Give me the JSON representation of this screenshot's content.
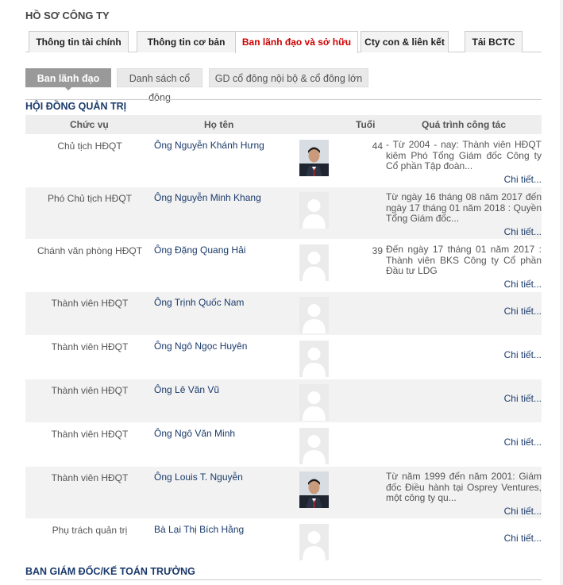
{
  "header": {
    "title": "HỒ SƠ CÔNG TY"
  },
  "tabs": [
    {
      "label": "Thông tin tài chính"
    },
    {
      "label": "Thông tin cơ bản"
    },
    {
      "label": "Ban lãnh đạo và sở hữu",
      "active": true
    },
    {
      "label": "Cty con & liên kết"
    },
    {
      "label": "Tải BCTC"
    }
  ],
  "subtabs": [
    {
      "label": "Ban lãnh đạo",
      "active": true
    },
    {
      "label": "Danh sách cổ đông"
    },
    {
      "label": "GD cổ đông nội bộ & cổ đông lớn"
    }
  ],
  "board": {
    "title": "HỘI ĐỒNG QUẢN TRỊ",
    "columns": {
      "position": "Chức vụ",
      "name": "Họ tên",
      "age": "Tuổi",
      "work": "Quá trình công tác"
    },
    "rows": [
      {
        "position": "Chủ tịch HĐQT",
        "name": "Ông Nguyễn Khánh Hưng",
        "age": "44",
        "photo": "photo",
        "work": "- Từ 2004 - nay: Thành viên HĐQT kiêm Phó Tổng Giám đốc Công ty Cổ phần Tập đoàn...",
        "more": "Chi tiết..."
      },
      {
        "position": "Phó Chủ tịch HĐQT",
        "name": "Ông Nguyễn Minh Khang",
        "age": "",
        "photo": "default",
        "work": "Từ ngày 16 tháng 08 năm 2017 đến ngày 17 tháng 01 năm 2018 : Quyền Tổng Giám đốc...",
        "more": "Chi tiết..."
      },
      {
        "position": "Chánh văn phòng HĐQT",
        "name": "Ông Đặng Quang Hải",
        "age": "39",
        "photo": "default",
        "work": "Đến ngày 17 tháng 01 năm 2017 : Thành viên BKS Công ty Cổ phần Đầu tư LDG",
        "more": "Chi tiết..."
      },
      {
        "position": "Thành viên HĐQT",
        "name": "Ông Trịnh Quốc Nam",
        "age": "",
        "photo": "default",
        "work": "",
        "more": "Chi tiết..."
      },
      {
        "position": "Thành viên HĐQT",
        "name": "Ông Ngô Ngọc Huyên",
        "age": "",
        "photo": "default",
        "work": "",
        "more": "Chi tiết..."
      },
      {
        "position": "Thành viên HĐQT",
        "name": "Ông Lê Văn Vũ",
        "age": "",
        "photo": "default",
        "work": "",
        "more": "Chi tiết..."
      },
      {
        "position": "Thành viên HĐQT",
        "name": "Ông Ngô Văn Minh",
        "age": "",
        "photo": "default",
        "work": "",
        "more": "Chi tiết..."
      },
      {
        "position": "Thành viên HĐQT",
        "name": "Ông Louis T. Nguyễn",
        "age": "",
        "photo": "photo",
        "work": "Từ năm 1999 đến năm 2001: Giám đốc Điều hành tại Osprey Ventures, một công ty qu...",
        "more": "Chi tiết..."
      },
      {
        "position": "Phụ trách quản trị",
        "name": "Bà Lại Thị Bích Hằng",
        "age": "",
        "photo": "default",
        "work": "",
        "more": "Chi tiết..."
      }
    ]
  },
  "management": {
    "title": "BAN GIÁM ĐỐC/KẾ TOÁN TRƯỞNG"
  }
}
